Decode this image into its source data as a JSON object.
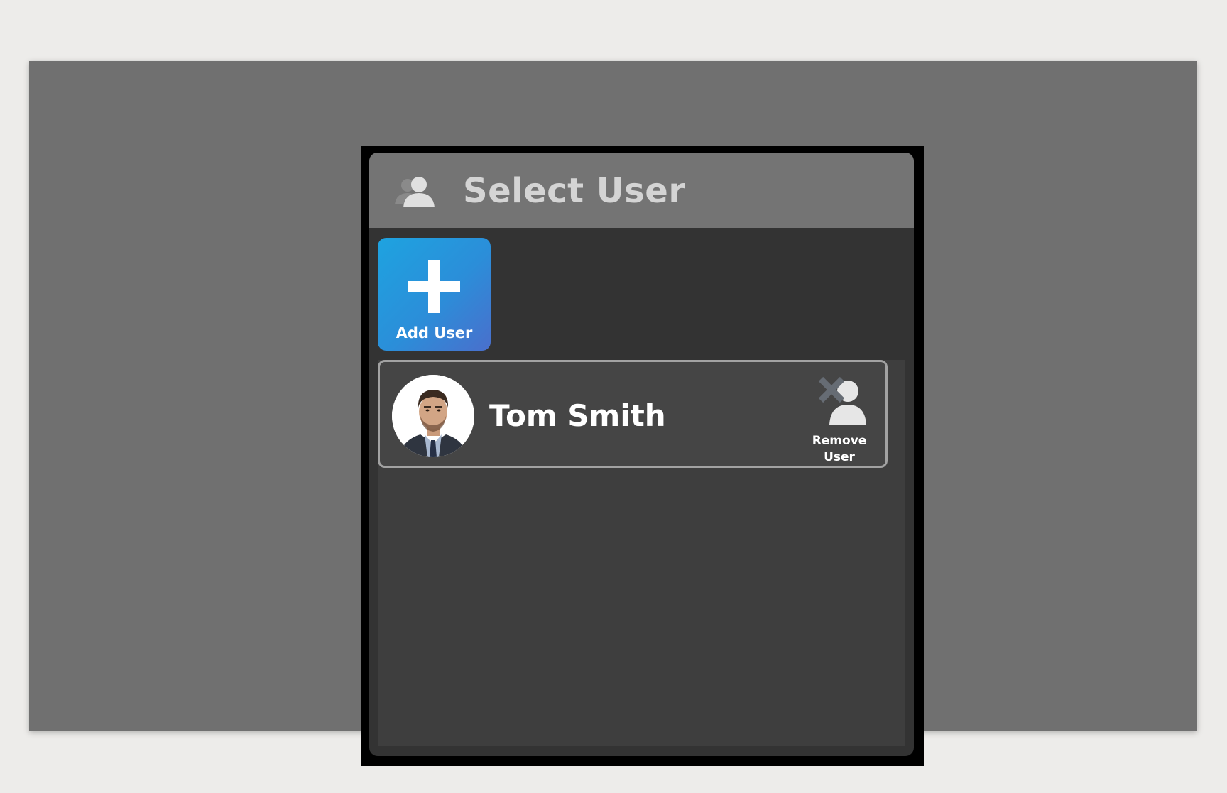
{
  "dialog": {
    "title": "Select User",
    "header_icon": "users-icon"
  },
  "add_user": {
    "label": "Add User",
    "icon": "plus-icon",
    "gradient": [
      "#1ea3e0",
      "#4a6fcc"
    ]
  },
  "users": [
    {
      "name": "Tom Smith",
      "avatar": "user-photo",
      "remove_label_line1": "Remove",
      "remove_label_line2": "User",
      "remove_icon": "remove-user-icon"
    }
  ]
}
